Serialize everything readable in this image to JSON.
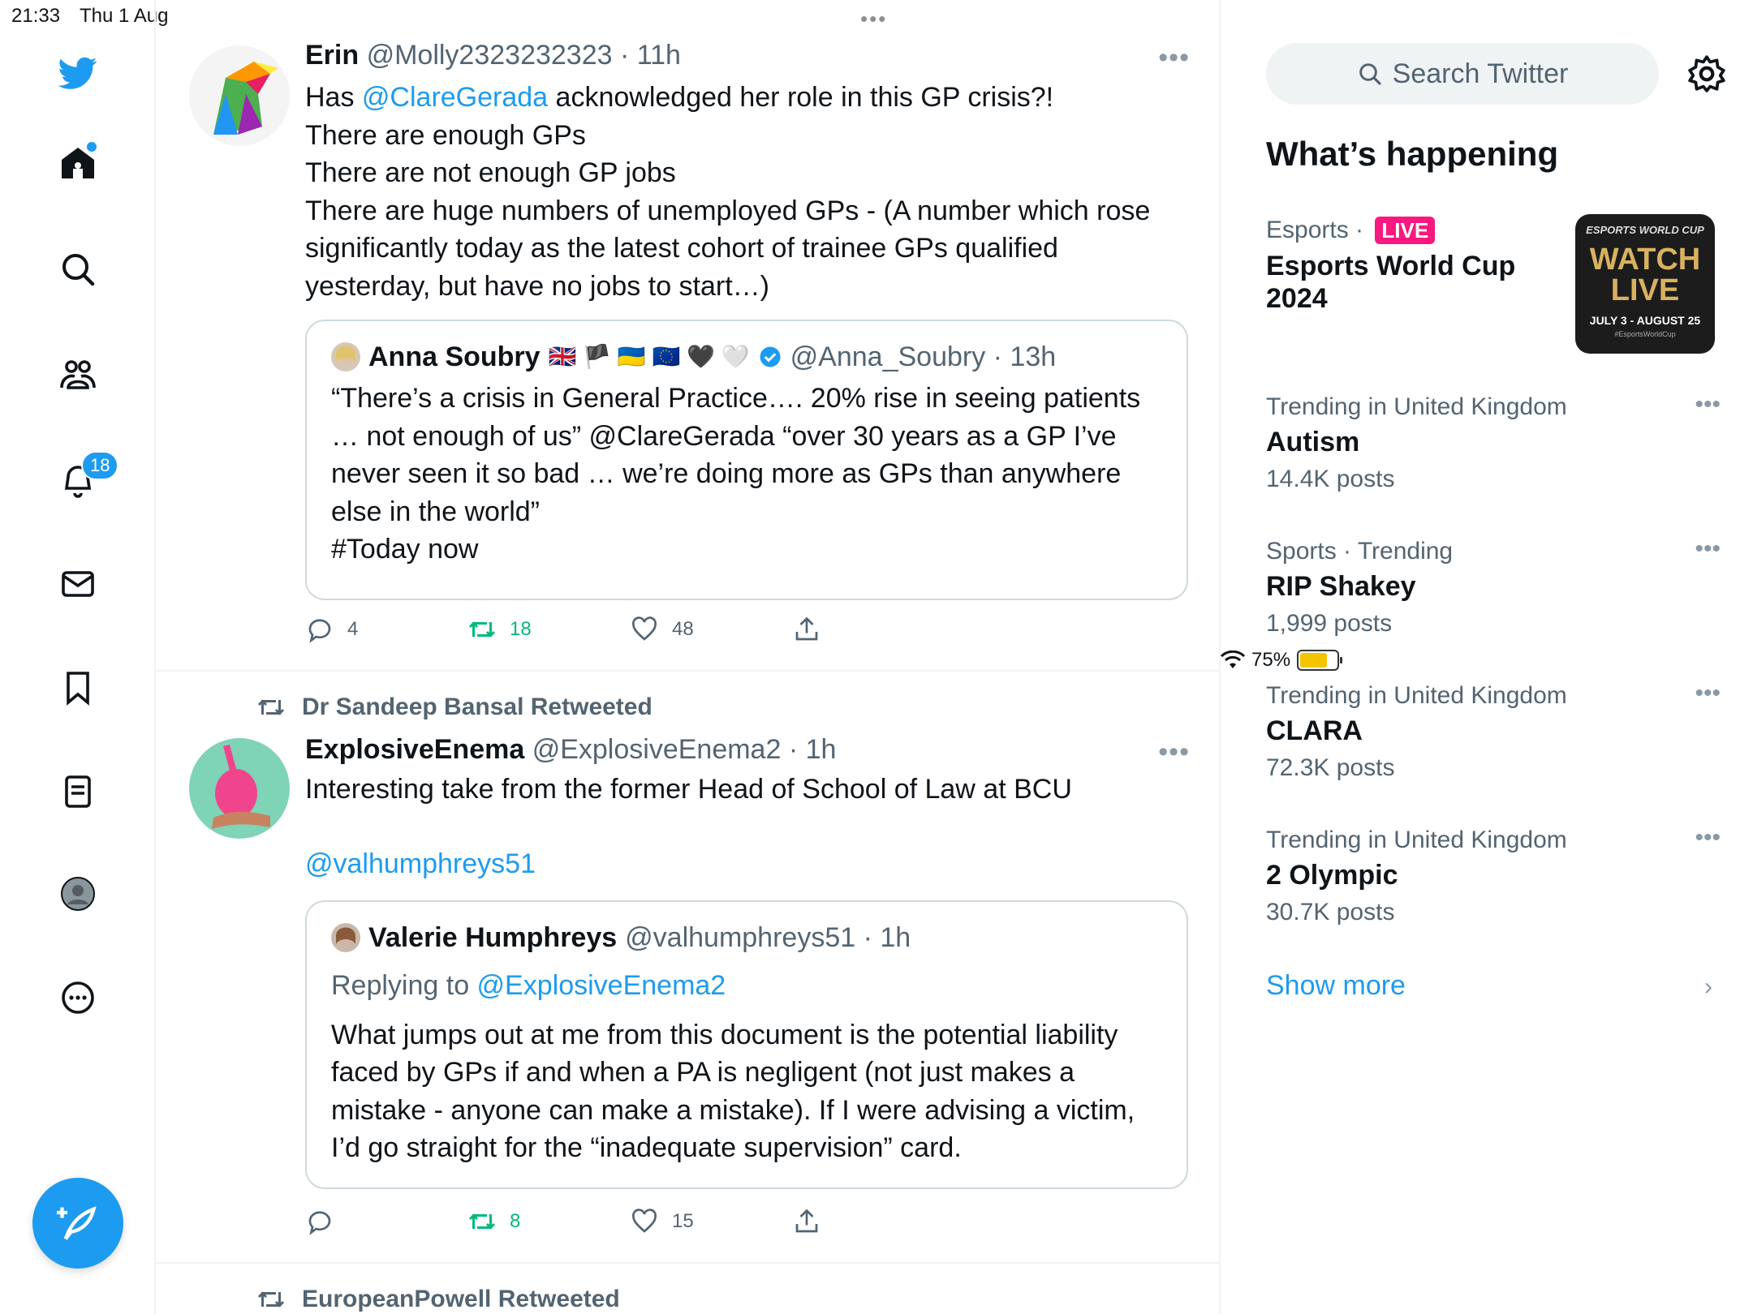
{
  "status_bar": {
    "time": "21:33",
    "date": "Thu 1 Aug",
    "battery": "75%"
  },
  "nav": {
    "notifications_badge": "18"
  },
  "tweets": [
    {
      "name": "Erin",
      "meta": "@Molly2323232323 · 11h",
      "text_pre": "Has ",
      "mention": "@ClareGerada",
      "text_post": " acknowledged her role in this GP crisis?!\nThere are enough GPs\nThere are not enough GP jobs\nThere are huge numbers of unemployed GPs - (A number which rose significantly today as the latest cohort of trainee GPs qualified yesterday, but have no jobs to start…)",
      "quote": {
        "name": "Anna Soubry",
        "flags": "🇬🇧 🏴 🇺🇦 🇪🇺 🖤 🤍",
        "meta": "@Anna_Soubry · 13h",
        "text": "“There’s a crisis in General Practice…. 20% rise in seeing patients … not enough of us” @ClareGerada “over 30 years as a GP I’ve never seen it so bad … we’re doing more as GPs than anywhere else in the world”\n#Today now"
      },
      "replies": "4",
      "retweets": "18",
      "likes": "48"
    },
    {
      "retweeted_by": "Dr Sandeep Bansal Retweeted",
      "name": "ExplosiveEnema",
      "meta": "@ExplosiveEnema2 · 1h",
      "text": "Interesting take from the former Head of School of Law at BCU",
      "mention": "@valhumphreys51",
      "quote": {
        "name": "Valerie Humphreys",
        "meta": "@valhumphreys51 · 1h",
        "replying_prefix": "Replying to ",
        "replying_to": "@ExplosiveEnema2",
        "text": "What jumps out at me from this document is the potential liability faced by GPs if and when a PA is negligent (not just makes a mistake - anyone can make a mistake). If I were advising a victim, I’d go straight for the “inadequate supervision” card."
      },
      "replies": "",
      "retweets": "8",
      "likes": "15"
    },
    {
      "retweeted_by": "EuropeanPowell Retweeted"
    }
  ],
  "sidebar": {
    "search_placeholder": "Search Twitter",
    "heading": "What’s happening",
    "esports": {
      "category": "Esports",
      "live": "LIVE",
      "title": "Esports World Cup 2024",
      "image_top": "ESPORTS WORLD CUP",
      "image_main": "WATCH LIVE",
      "image_dates": "JULY 3 - AUGUST 25",
      "image_tag": "#EsportsWorldCup"
    },
    "trends": [
      {
        "context": "Trending in United Kingdom",
        "title": "Autism",
        "count": "14.4K posts"
      },
      {
        "context": "Sports · Trending",
        "title": "RIP Shakey",
        "count": "1,999 posts"
      },
      {
        "context": "Trending in United Kingdom",
        "title": "CLARA",
        "count": "72.3K posts"
      },
      {
        "context": "Trending in United Kingdom",
        "title": "2 Olympic",
        "count": "30.7K posts"
      }
    ],
    "show_more": "Show more"
  }
}
